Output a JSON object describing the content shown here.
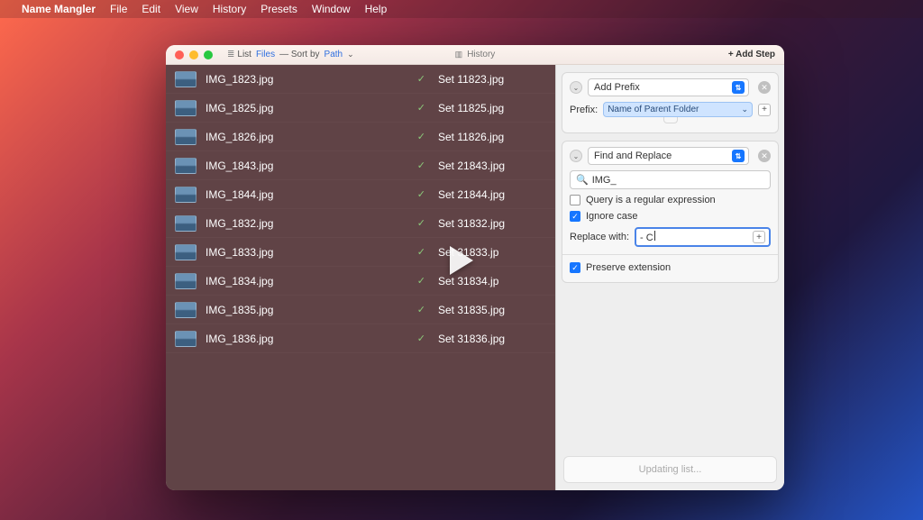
{
  "menubar": {
    "app_name": "Name Mangler",
    "items": [
      "File",
      "Edit",
      "View",
      "History",
      "Presets",
      "Window",
      "Help"
    ]
  },
  "titlebar": {
    "list_label": "List",
    "files_link": "Files",
    "sort_label": "— Sort by",
    "path_link": "Path",
    "history_label": "History",
    "add_step_label": "+ Add Step"
  },
  "files": [
    {
      "name": "IMG_1823.jpg",
      "new": "Set 11823.jpg"
    },
    {
      "name": "IMG_1825.jpg",
      "new": "Set 11825.jpg"
    },
    {
      "name": "IMG_1826.jpg",
      "new": "Set 11826.jpg"
    },
    {
      "name": "IMG_1843.jpg",
      "new": "Set 21843.jpg"
    },
    {
      "name": "IMG_1844.jpg",
      "new": "Set 21844.jpg"
    },
    {
      "name": "IMG_1832.jpg",
      "new": "Set 31832.jpg"
    },
    {
      "name": "IMG_1833.jpg",
      "new": "Set 31833.jp"
    },
    {
      "name": "IMG_1834.jpg",
      "new": "Set 31834.jp"
    },
    {
      "name": "IMG_1835.jpg",
      "new": "Set 31835.jpg"
    },
    {
      "name": "IMG_1836.jpg",
      "new": "Set 31836.jpg"
    }
  ],
  "step1": {
    "type": "Add Prefix",
    "prefix_label": "Prefix:",
    "prefix_token": "Name of Parent Folder"
  },
  "step2": {
    "type": "Find and Replace",
    "search_value": "IMG_",
    "regex_label": "Query is a regular expression",
    "regex_checked": false,
    "ignore_label": "Ignore case",
    "ignore_checked": true,
    "replace_label": "Replace with:",
    "replace_value": "- C",
    "preserve_label": "Preserve extension",
    "preserve_checked": true
  },
  "status": {
    "text": "Updating list..."
  }
}
